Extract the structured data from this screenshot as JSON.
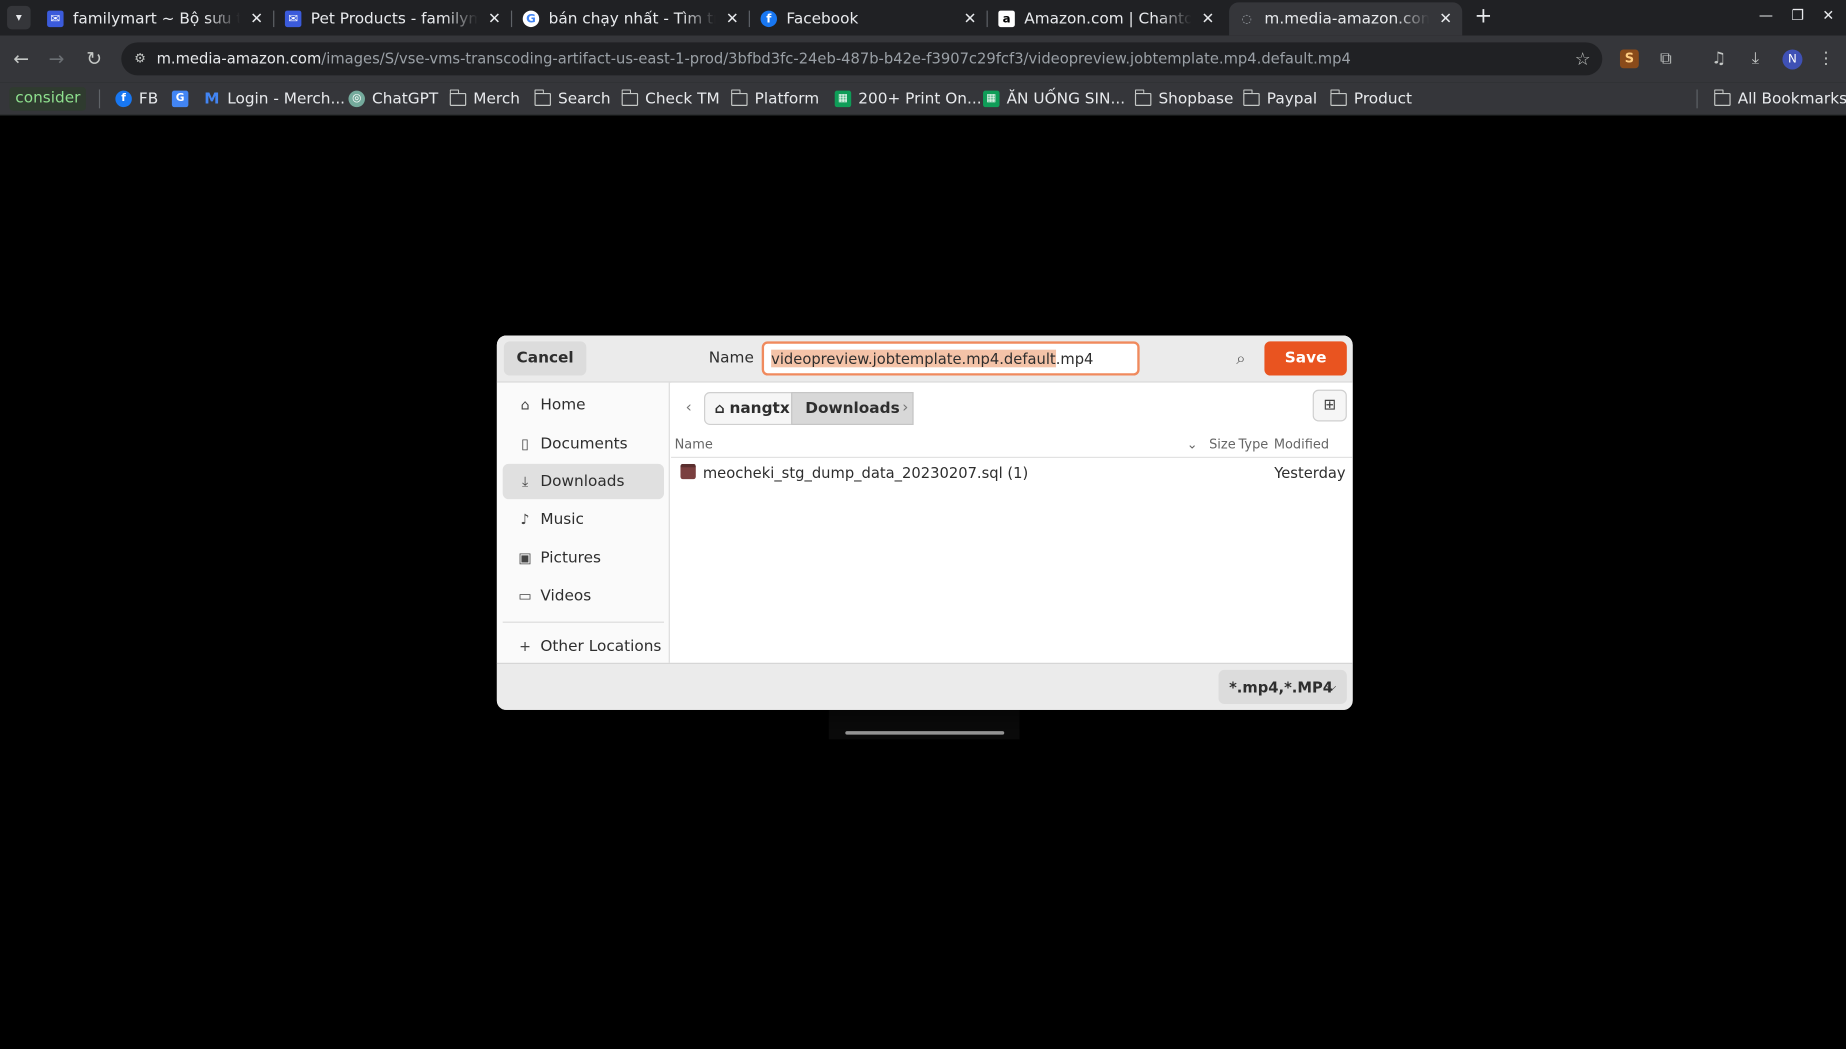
{
  "browser": {
    "tabs": [
      {
        "title": "familymart ~ Bộ sưu tập",
        "favicon": "mail-icon",
        "active": false
      },
      {
        "title": "Pet Products - familymart",
        "favicon": "mail-icon",
        "active": false
      },
      {
        "title": "bán chạy nhất - Tìm trên Google",
        "favicon": "google-icon",
        "active": false
      },
      {
        "title": "Facebook",
        "favicon": "facebook-icon",
        "active": false
      },
      {
        "title": "Amazon.com | Chantomo",
        "favicon": "amazon-icon",
        "active": false
      },
      {
        "title": "m.media-amazon.com/images",
        "favicon": "globe-icon",
        "active": true
      }
    ],
    "url_host": "m.media-amazon.com",
    "url_path": "/images/S/vse-vms-transcoding-artifact-us-east-1-prod/3bfbd3fc-24eb-487b-b42e-f3907c29fcf3/videopreview.jobtemplate.mp4.default.mp4",
    "profile_initial": "N",
    "bookmarks": {
      "first": "consider",
      "items": [
        {
          "label": "FB",
          "icon": "facebook-icon"
        },
        {
          "label": "",
          "icon": "translate-icon"
        },
        {
          "label": "Login - Merch...",
          "icon": "gmail-icon"
        },
        {
          "label": "ChatGPT",
          "icon": "chatgpt-icon"
        },
        {
          "label": "Merch",
          "icon": "folder-icon"
        },
        {
          "label": "Search",
          "icon": "folder-icon"
        },
        {
          "label": "Check TM",
          "icon": "folder-icon"
        },
        {
          "label": "Platform",
          "icon": "folder-icon"
        },
        {
          "label": "200+ Print On...",
          "icon": "sheets-icon"
        },
        {
          "label": "ĂN UỐNG SIN...",
          "icon": "sheets-icon"
        },
        {
          "label": "Shopbase",
          "icon": "folder-icon"
        },
        {
          "label": "Paypal",
          "icon": "folder-icon"
        },
        {
          "label": "Product",
          "icon": "folder-icon"
        }
      ],
      "all_bookmarks": "All Bookmarks"
    }
  },
  "dialog": {
    "cancel_label": "Cancel",
    "name_label": "Name",
    "filename_selected": "videopreview.jobtemplate.mp4.default",
    "filename_ext": ".mp4",
    "save_label": "Save",
    "places": [
      {
        "label": "Home",
        "icon": "home-icon"
      },
      {
        "label": "Documents",
        "icon": "documents-icon"
      },
      {
        "label": "Downloads",
        "icon": "downloads-icon",
        "selected": true
      },
      {
        "label": "Music",
        "icon": "music-icon"
      },
      {
        "label": "Pictures",
        "icon": "pictures-icon"
      },
      {
        "label": "Videos",
        "icon": "videos-icon"
      }
    ],
    "other_locations": "Other Locations",
    "path": [
      "nangtx",
      "Downloads"
    ],
    "columns": {
      "name": "Name",
      "size": "Size",
      "type": "Type",
      "modified": "Modified"
    },
    "files": [
      {
        "name": "meocheki_stg_dump_data_20230207.sql (1)",
        "modified": "Yesterday"
      }
    ],
    "filter": "*.mp4,*.MP4"
  },
  "colors": {
    "accent": "#e95420",
    "focus_border": "#f08a5d",
    "selection": "#f4c3a8"
  }
}
